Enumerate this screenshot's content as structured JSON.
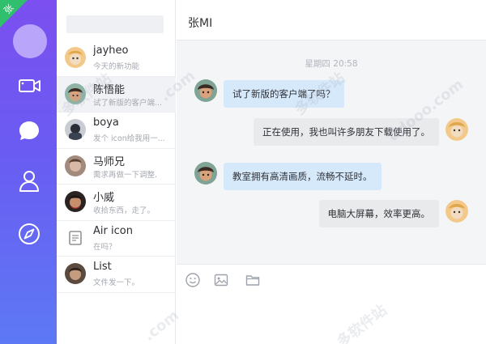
{
  "app": {
    "corner_badge": "张"
  },
  "rail": {
    "icons": [
      "avatar",
      "video-icon",
      "chat-icon",
      "contacts-icon",
      "compass-icon"
    ],
    "accent_top": "#7b4ff0",
    "accent_bottom": "#5d79f4",
    "badge_color": "#2fbf6d"
  },
  "search": {
    "placeholder": "",
    "value": ""
  },
  "contacts": [
    {
      "name": "jayheo",
      "preview": "今天的新功能",
      "active": false
    },
    {
      "name": "陈悟能",
      "preview": "试了新版的客户端...",
      "active": true
    },
    {
      "name": "boya",
      "preview": "发个 icon给我用一...",
      "active": false
    },
    {
      "name": "马师兄",
      "preview": "需求再做一下调整.",
      "active": false
    },
    {
      "name": "小威",
      "preview": "收拾东西，走了。",
      "active": false
    },
    {
      "name": "Air icon",
      "preview": "在吗？",
      "active": false
    },
    {
      "name": "List",
      "preview": "文件发一下。",
      "active": false
    }
  ],
  "chat": {
    "title": "张MI",
    "timestamp": "星期四 20:58",
    "messages": [
      {
        "direction": "in",
        "text": "试了新版的客户端了吗？"
      },
      {
        "direction": "out",
        "text": "正在使用，我也叫许多朋友下载使用了。"
      },
      {
        "direction": "in",
        "text": "教室拥有高清画质，流畅不延时。"
      },
      {
        "direction": "out",
        "text": "电脑大屏幕，效率更高。"
      }
    ],
    "bubble_in_color": "#d6e9fb",
    "bubble_out_color": "#e9eaec"
  },
  "composer": {
    "tools": [
      "emoji-icon",
      "image-icon",
      "folder-icon"
    ]
  },
  "watermarks": [
    "多软件站",
    "多软件站",
    "多软件站",
    ".com",
    ".com",
    "ddooo.com"
  ]
}
